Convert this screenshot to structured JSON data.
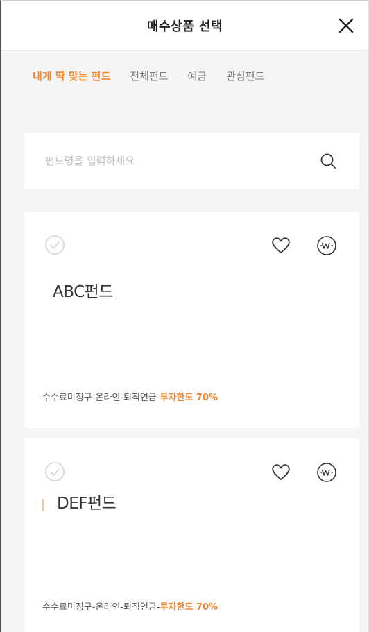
{
  "header": {
    "title": "매수상품 선택"
  },
  "tabs": [
    {
      "label": "내게 딱 맞는 펀드",
      "active": true
    },
    {
      "label": "전체펀드",
      "active": false
    },
    {
      "label": "예금",
      "active": false
    },
    {
      "label": "관심펀드",
      "active": false
    }
  ],
  "search": {
    "placeholder": "펀드명을 입력하세요",
    "value": ""
  },
  "funds": [
    {
      "name": "ABC펀드",
      "desc_prefix": "수수료미징구-온라인-퇴직연금-",
      "desc_highlight": "투자한도 70%"
    },
    {
      "name": "DEF펀드",
      "desc_prefix": "수수료미징구-온라인-퇴직연금-",
      "desc_highlight": "투자한도 70%"
    }
  ],
  "colors": {
    "accent": "#f2862e",
    "background": "#f5f5f5",
    "card": "#ffffff"
  },
  "icons": {
    "close": "close-icon",
    "search": "search-icon",
    "check": "check-circle-icon",
    "heart": "heart-icon",
    "won": "won-coin-icon"
  }
}
